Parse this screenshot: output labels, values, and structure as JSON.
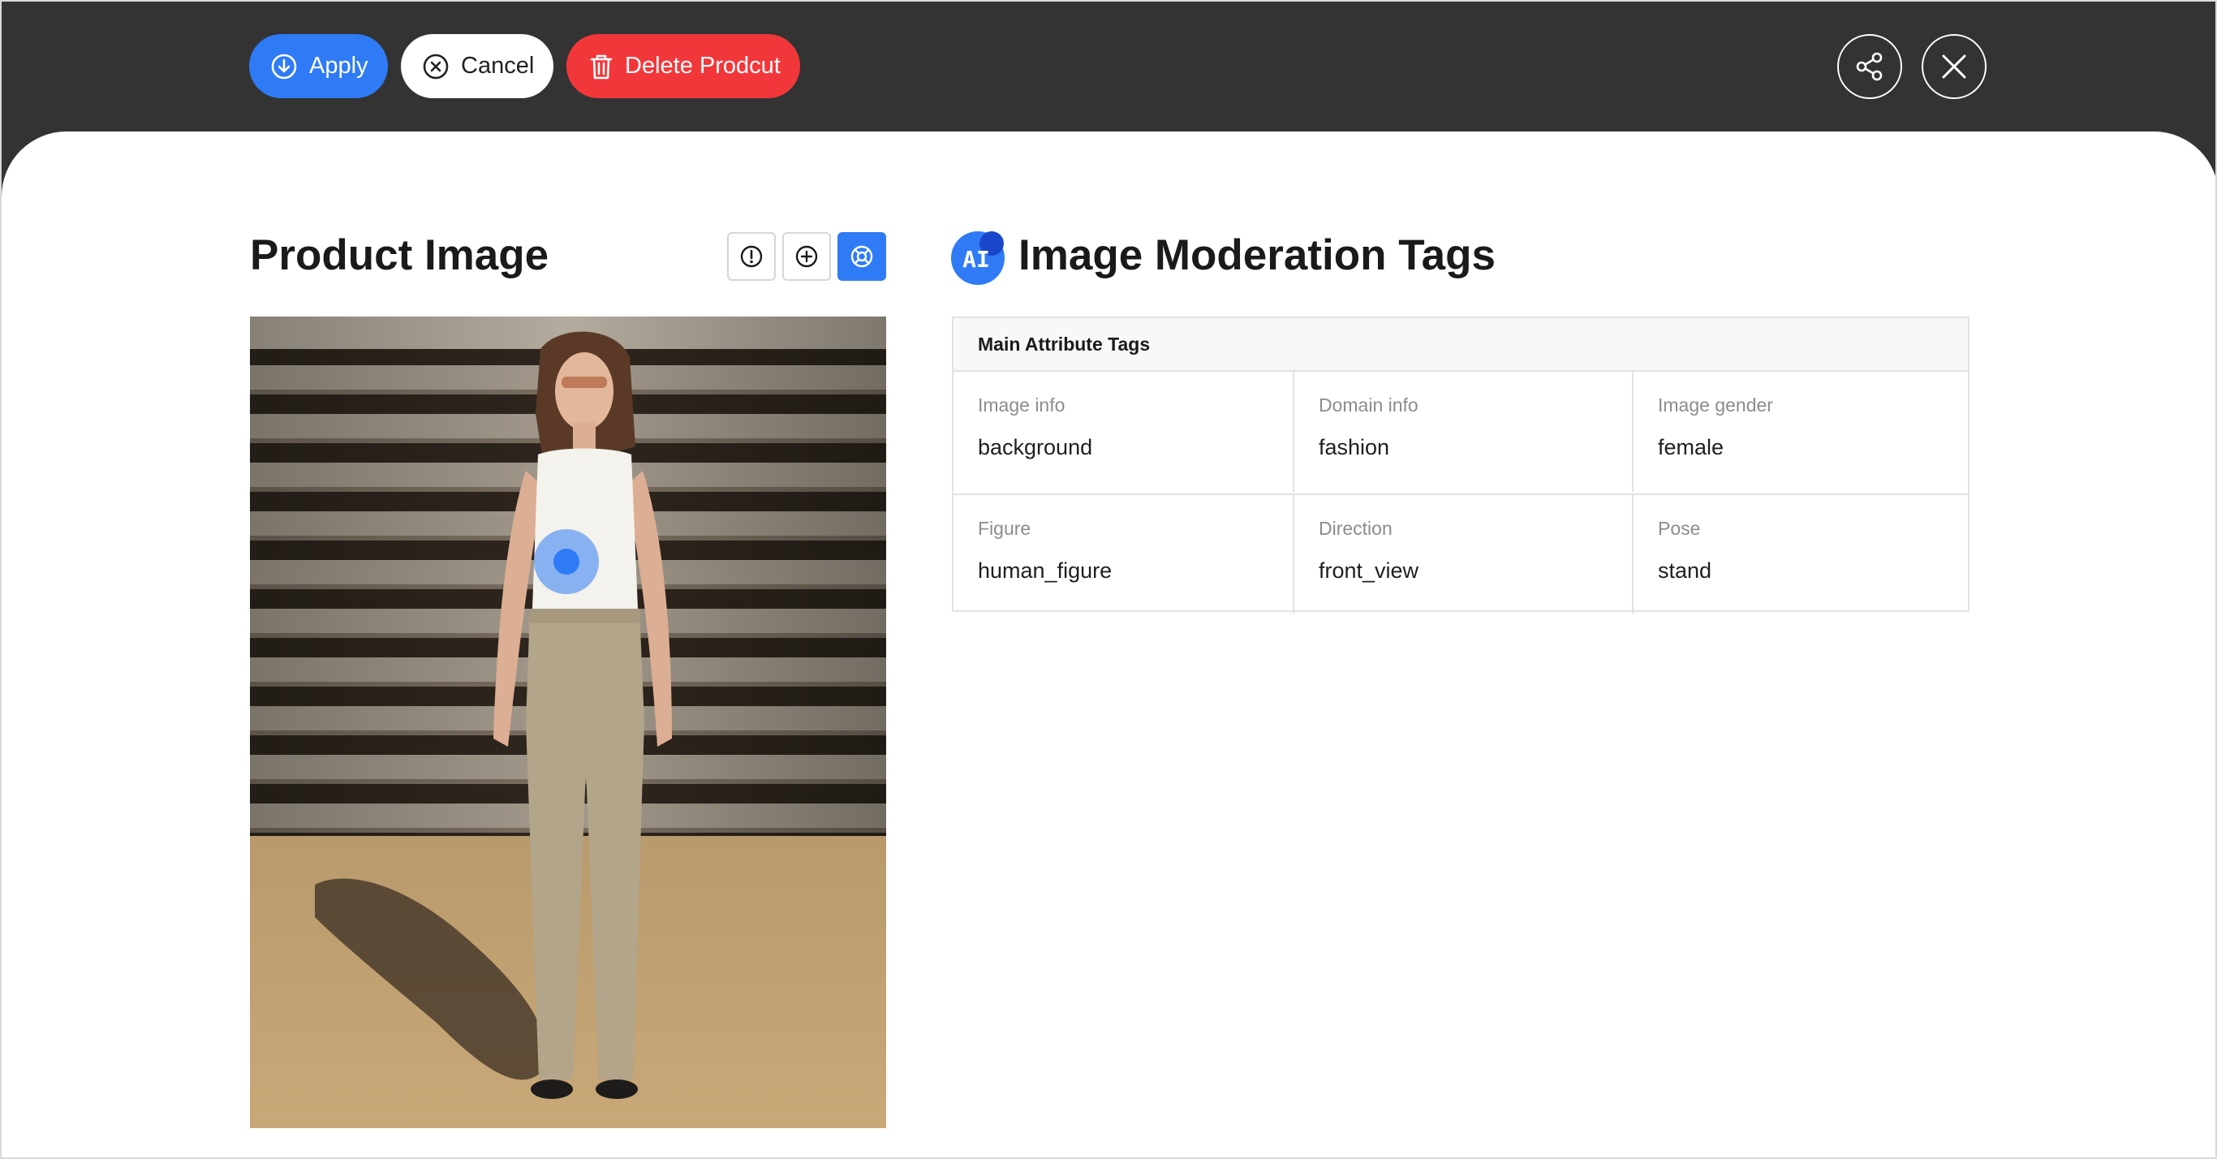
{
  "toolbar": {
    "apply_label": "Apply",
    "cancel_label": "Cancel",
    "delete_label": "Delete Prodcut",
    "share_icon": "share-icon",
    "close_icon": "close-icon"
  },
  "product_image": {
    "title": "Product Image",
    "tools": [
      "info-icon",
      "zoom-in-icon",
      "target-icon"
    ]
  },
  "moderation": {
    "badge": "AI",
    "title": "Image Moderation Tags",
    "table": {
      "header": "Main Attribute Tags",
      "rows": [
        [
          {
            "label": "Image info",
            "value": "background"
          },
          {
            "label": "Domain info",
            "value": "fashion"
          },
          {
            "label": "Image gender",
            "value": "female"
          }
        ],
        [
          {
            "label": "Figure",
            "value": "human_figure"
          },
          {
            "label": "Direction",
            "value": "front_view"
          },
          {
            "label": "Pose",
            "value": "stand"
          }
        ]
      ]
    }
  },
  "colors": {
    "topbar": "#333333",
    "accent": "#2f7bf5",
    "danger": "#f2373b",
    "border": "#e2e2e2"
  }
}
